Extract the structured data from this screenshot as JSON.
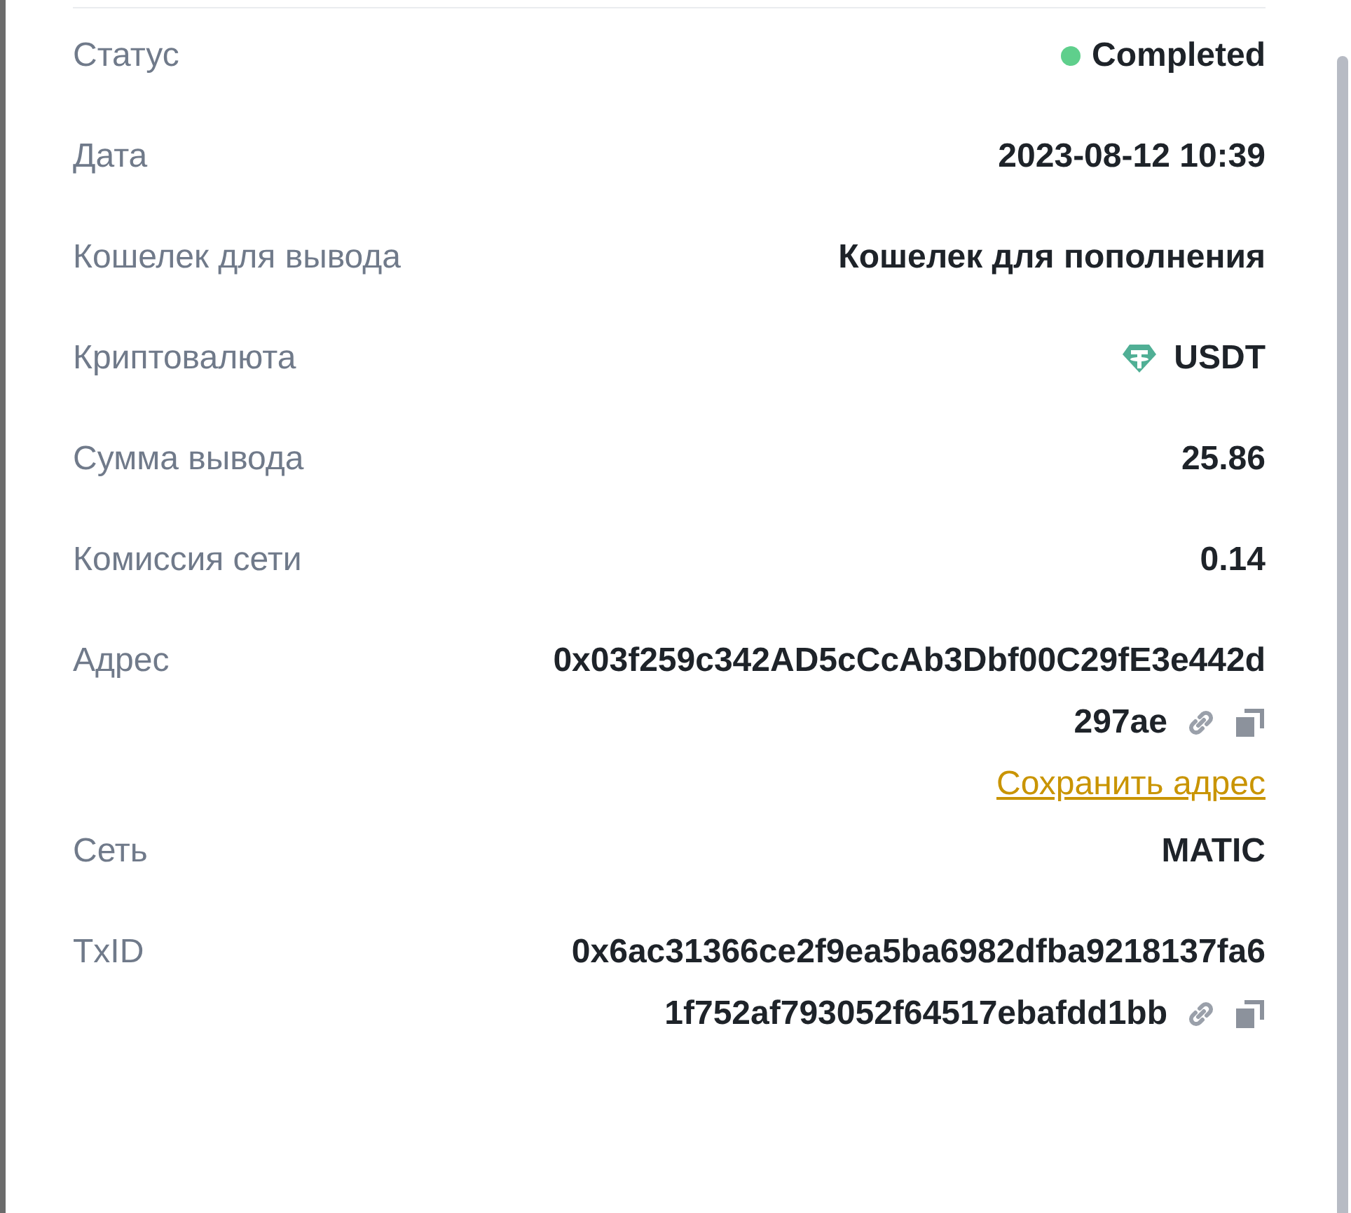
{
  "rows": [
    {
      "kind": "status",
      "label": "Статус",
      "value": "Completed",
      "color": "#5fcf8c"
    },
    {
      "kind": "text",
      "label": "Дата",
      "value": "2023-08-12 10:39"
    },
    {
      "kind": "text",
      "label": "Кошелек для вывода",
      "value": "Кошелек для пополнения"
    },
    {
      "kind": "coin",
      "label": "Криптовалюта",
      "value": "USDT"
    },
    {
      "kind": "text",
      "label": "Сумма вывода",
      "value": "25.86"
    },
    {
      "kind": "text",
      "label": "Комиссия сети",
      "value": "0.14"
    },
    {
      "kind": "hash",
      "label": "Адрес",
      "lines": [
        "0x03f259c342AD5cCcAb3Dbf00C29fE3e442d",
        "297ae"
      ],
      "link": "Сохранить адрес"
    },
    {
      "kind": "text",
      "label": "Сеть",
      "value": "MATIC"
    },
    {
      "kind": "hash",
      "label": "TxID",
      "lines": [
        "0x6ac31366ce2f9ea5ba6982dfba9218137fa6",
        "1f752af793052f64517ebafdd1bb"
      ]
    }
  ]
}
